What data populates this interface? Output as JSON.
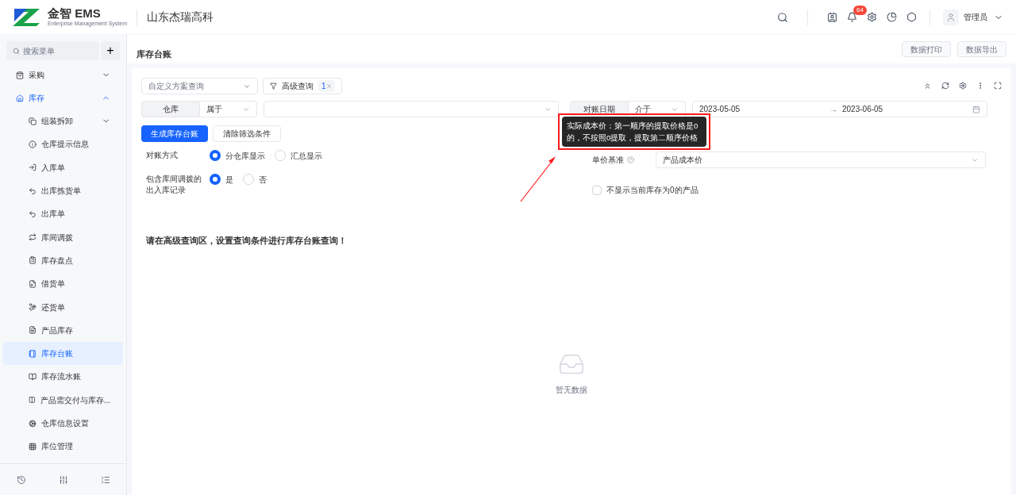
{
  "header": {
    "brand": "金智 EMS",
    "brand_subtitle": "Enterprise Management System",
    "company": "山东杰瑞高科",
    "notification_count": "64",
    "user": "管理员"
  },
  "sidebar": {
    "search_placeholder": "搜索菜单",
    "add_label": "+",
    "items": [
      {
        "label": "采购",
        "expanded": false,
        "selected": false
      },
      {
        "label": "库存",
        "expanded": true,
        "selected": true,
        "children": [
          {
            "label": "组装拆卸",
            "kind": "group",
            "expanded": false,
            "selected": false
          },
          {
            "label": "仓库提示信息",
            "kind": "link",
            "selected": false
          },
          {
            "label": "入库单",
            "kind": "link",
            "selected": false
          },
          {
            "label": "出库拣货单",
            "kind": "link",
            "selected": false
          },
          {
            "label": "出库单",
            "kind": "link",
            "selected": false
          },
          {
            "label": "库间调拨",
            "kind": "link",
            "selected": false
          },
          {
            "label": "库存盘点",
            "kind": "link",
            "selected": false
          },
          {
            "label": "借货单",
            "kind": "link",
            "selected": false
          },
          {
            "label": "还货单",
            "kind": "link",
            "selected": false
          },
          {
            "label": "产品库存",
            "kind": "link",
            "selected": false
          },
          {
            "label": "库存台账",
            "kind": "link",
            "selected": true
          },
          {
            "label": "库存流水账",
            "kind": "link",
            "selected": false
          },
          {
            "label": "产品需交付与库存...",
            "kind": "link",
            "selected": false
          },
          {
            "label": "仓库信息设置",
            "kind": "link",
            "selected": false
          },
          {
            "label": "库位管理",
            "kind": "link",
            "selected": false
          }
        ]
      }
    ]
  },
  "page": {
    "title": "库存台账",
    "actions": [
      {
        "label": "数据打印",
        "disabled": true
      },
      {
        "label": "数据导出",
        "disabled": true
      }
    ]
  },
  "query": {
    "scheme_placeholder": "自定义方案查询",
    "advanced_label": "高级查询",
    "advanced_count": "1",
    "filters": [
      {
        "kind": "select",
        "field": "仓库",
        "operator": "属于"
      },
      {
        "kind": "range",
        "field": "对账日期",
        "operator": "介于",
        "start": "2023-05-05",
        "separator": "→",
        "end": "2023-06-05"
      }
    ],
    "buttons": [
      {
        "label": "生成库存台账",
        "primary": true
      },
      {
        "label": "清除筛选条件",
        "primary": false
      }
    ],
    "options": [
      {
        "label": "对账方式",
        "choices": [
          {
            "label": "分仓库显示",
            "selected": true
          },
          {
            "label": "汇总显示",
            "selected": false
          }
        ]
      },
      {
        "label": "包含库间调拨的出入库记录",
        "choices": [
          {
            "label": "是",
            "selected": true
          },
          {
            "label": "否",
            "selected": false
          }
        ]
      }
    ],
    "price_basis": {
      "label": "单价基准",
      "value": "产品成本价",
      "tooltip": "实际成本价：第一顺序的提取价格是0的，不按照0提取，提取第二顺序价格"
    },
    "hide_zero": {
      "label": "不显示当前库存为0的产品",
      "checked": false
    }
  },
  "message": "请在高级查询区，设置查询条件进行库存台账查询！",
  "empty_text": "暂无数据"
}
